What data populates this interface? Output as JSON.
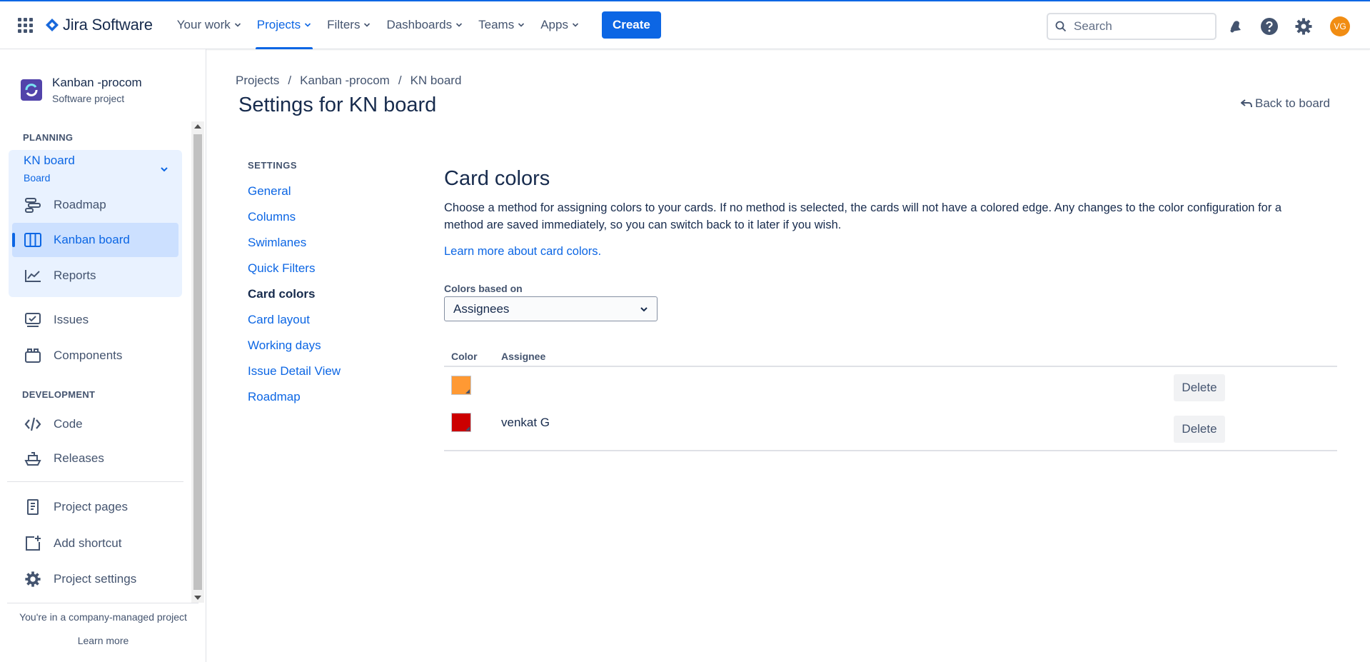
{
  "topnav": {
    "product": "Jira Software",
    "items": [
      {
        "label": "Your work",
        "active": false
      },
      {
        "label": "Projects",
        "active": true
      },
      {
        "label": "Filters",
        "active": false
      },
      {
        "label": "Dashboards",
        "active": false
      },
      {
        "label": "Teams",
        "active": false
      },
      {
        "label": "Apps",
        "active": false
      }
    ],
    "create_label": "Create",
    "search_placeholder": "Search",
    "avatar_initials": "VG",
    "icons": [
      "app-switcher-icon",
      "notifications-icon",
      "help-icon",
      "settings-icon"
    ]
  },
  "sidebar": {
    "project_name": "Kanban -procom",
    "project_type": "Software project",
    "planning_title": "PLANNING",
    "board_name": "KN board",
    "board_sub": "Board",
    "planning_items": [
      {
        "label": "Roadmap",
        "icon": "roadmap-icon"
      },
      {
        "label": "Kanban board",
        "icon": "board-icon",
        "selected": true
      },
      {
        "label": "Reports",
        "icon": "reports-icon"
      }
    ],
    "other_items": [
      {
        "label": "Issues",
        "icon": "issues-icon"
      },
      {
        "label": "Components",
        "icon": "components-icon"
      }
    ],
    "development_title": "DEVELOPMENT",
    "development_items": [
      {
        "label": "Code",
        "icon": "code-icon"
      },
      {
        "label": "Releases",
        "icon": "releases-icon"
      }
    ],
    "bottom_items": [
      {
        "label": "Project pages",
        "icon": "pages-icon"
      },
      {
        "label": "Add shortcut",
        "icon": "add-shortcut-icon"
      },
      {
        "label": "Project settings",
        "icon": "gear-icon"
      }
    ],
    "footer_text": "You're in a company-managed project",
    "footer_link": "Learn more"
  },
  "main": {
    "breadcrumb": [
      "Projects",
      "Kanban -procom",
      "KN board"
    ],
    "title": "Settings for KN board",
    "back_label": "Back to board",
    "settings_header": "SETTINGS",
    "settings_nav": [
      {
        "label": "General"
      },
      {
        "label": "Columns"
      },
      {
        "label": "Swimlanes"
      },
      {
        "label": "Quick Filters"
      },
      {
        "label": "Card colors",
        "current": true
      },
      {
        "label": "Card layout"
      },
      {
        "label": "Working days"
      },
      {
        "label": "Issue Detail View"
      },
      {
        "label": "Roadmap"
      }
    ],
    "section_title": "Card colors",
    "description": "Choose a method for assigning colors to your cards. If no method is selected, the cards will not have a colored edge. Any changes to the color configuration for a method are saved immediately, so you can switch back to it later if you wish.",
    "learn_more": "Learn more about card colors.",
    "colors_based_on_label": "Colors based on",
    "colors_based_on_value": "Assignees",
    "table": {
      "col_color": "Color",
      "col_assignee": "Assignee",
      "rows": [
        {
          "color": "#ff9933",
          "assignee": "",
          "action": "Delete"
        },
        {
          "color": "#cc0000",
          "assignee": "venkat G",
          "action": "Delete"
        }
      ]
    }
  }
}
